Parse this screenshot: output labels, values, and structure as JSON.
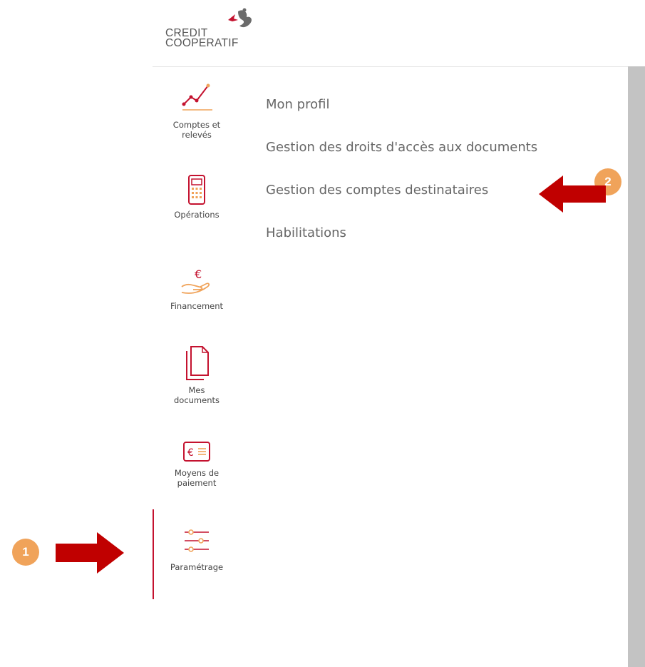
{
  "brand": {
    "line1": "CREDIT",
    "line2": "COOPERATIF"
  },
  "sidebar": {
    "items": [
      {
        "label": "Comptes et relevés",
        "icon": "chart-line-icon"
      },
      {
        "label": "Opérations",
        "icon": "calculator-icon"
      },
      {
        "label": "Financement",
        "icon": "euro-hand-icon"
      },
      {
        "label": "Mes documents",
        "icon": "documents-icon"
      },
      {
        "label": "Moyens de paiement",
        "icon": "payment-card-icon"
      },
      {
        "label": "Paramétrage",
        "icon": "sliders-icon"
      }
    ],
    "active": "Paramétrage"
  },
  "submenu": {
    "items": [
      {
        "label": "Mon profil"
      },
      {
        "label": "Gestion des droits d'accès aux documents"
      },
      {
        "label": "Gestion des comptes destinataires"
      },
      {
        "label": "Habilitations"
      }
    ]
  },
  "annotations": {
    "badge1": "1",
    "badge2": "2",
    "badge_color": "#f0a35a",
    "arrow_color": "#c00000"
  },
  "colors": {
    "accent": "#c4122f"
  }
}
